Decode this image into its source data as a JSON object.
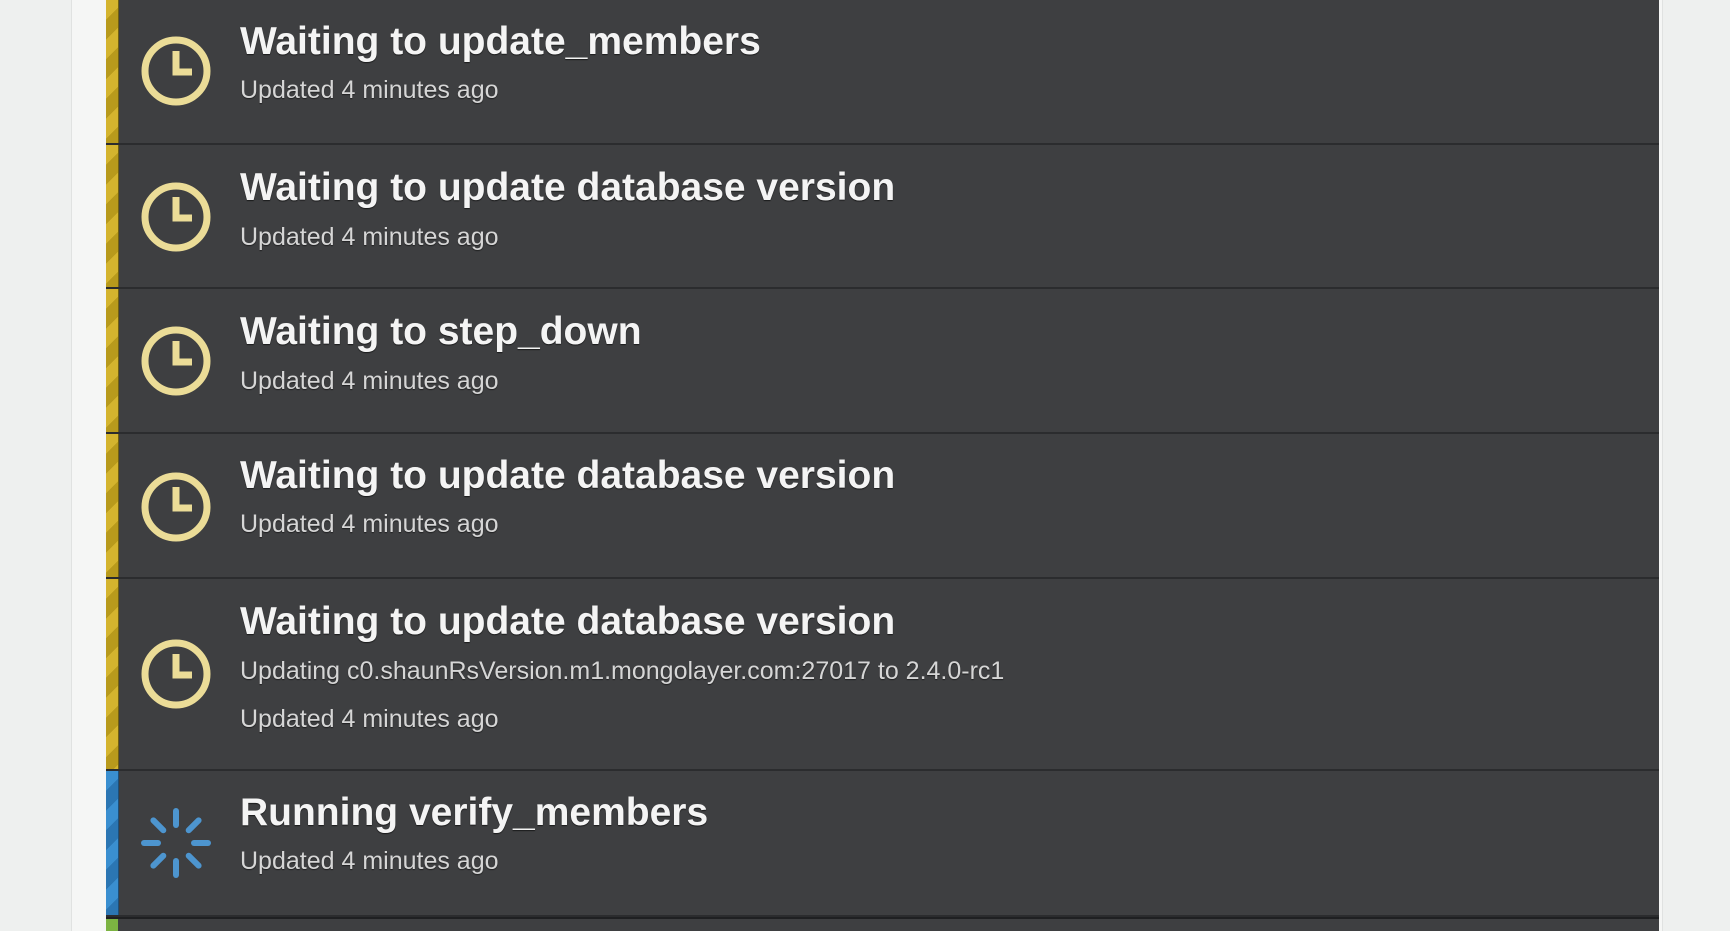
{
  "colors": {
    "waiting_accent": "#d4b42e",
    "running_accent": "#3a8fd0",
    "done_accent": "#7cb342",
    "row_bg": "#3e3f41",
    "clock_icon": "#ebdc97",
    "spinner_icon": "#4d95cf"
  },
  "tasks": [
    {
      "status": "waiting",
      "icon": "clock-icon",
      "title": "Waiting to update_members",
      "updated": "Updated 4 minutes ago"
    },
    {
      "status": "waiting",
      "icon": "clock-icon",
      "title": "Waiting to update database version",
      "updated": "Updated 4 minutes ago"
    },
    {
      "status": "waiting",
      "icon": "clock-icon",
      "title": "Waiting to step_down",
      "updated": "Updated 4 minutes ago"
    },
    {
      "status": "waiting",
      "icon": "clock-icon",
      "title": "Waiting to update database version",
      "updated": "Updated 4 minutes ago"
    },
    {
      "status": "waiting",
      "icon": "clock-icon",
      "title": "Waiting to update database version",
      "detail": "Updating c0.shaunRsVersion.m1.mongolayer.com:27017 to 2.4.0-rc1",
      "updated": "Updated 4 minutes ago"
    },
    {
      "status": "running",
      "icon": "spinner-icon",
      "title": "Running verify_members",
      "updated": "Updated 4 minutes ago"
    },
    {
      "status": "done",
      "icon": "",
      "title": "",
      "updated": ""
    }
  ]
}
